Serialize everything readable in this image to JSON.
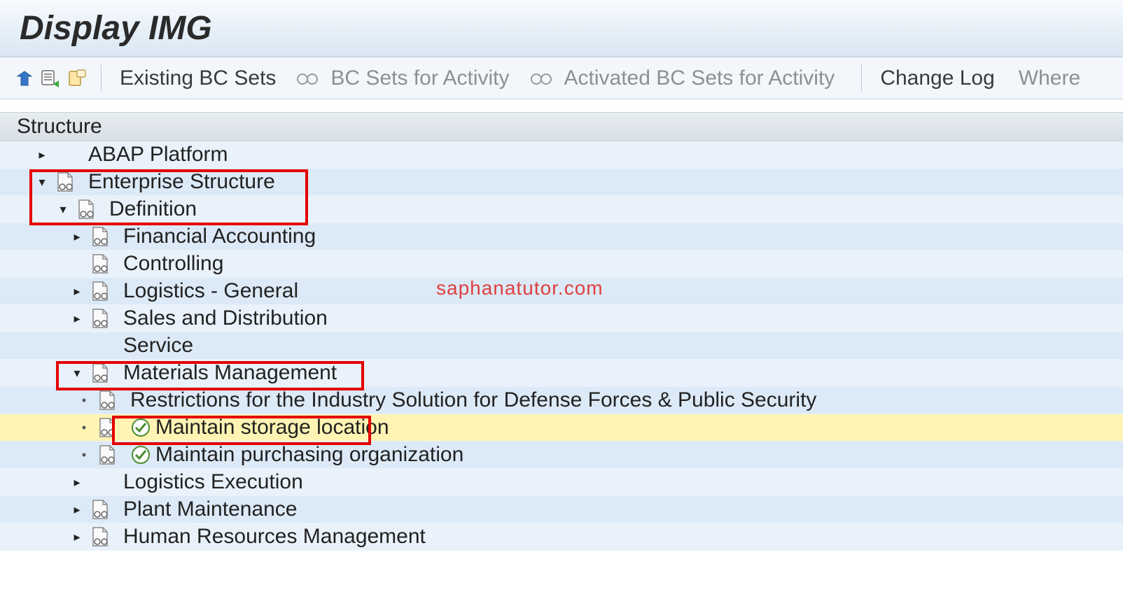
{
  "title": "Display IMG",
  "toolbar": {
    "existing_bc_sets": "Existing BC Sets",
    "bc_sets_for_activity": "BC Sets for Activity",
    "activated_bc_sets": "Activated BC Sets for Activity",
    "change_log": "Change Log",
    "where": "Where"
  },
  "section_header": "Structure",
  "watermark": "saphanatutor.com",
  "tree": {
    "abap_platform": "ABAP Platform",
    "enterprise_structure": "Enterprise Structure",
    "definition": "Definition",
    "financial_accounting": "Financial Accounting",
    "controlling": "Controlling",
    "logistics_general": "Logistics - General",
    "sales_and_distribution": "Sales and Distribution",
    "service": "Service",
    "materials_management": "Materials Management",
    "restrictions": "Restrictions for the Industry Solution for Defense Forces & Public Security",
    "maintain_storage_location": "Maintain storage location",
    "maintain_purchasing_org": "Maintain purchasing organization",
    "logistics_execution": "Logistics Execution",
    "plant_maintenance": "Plant Maintenance",
    "human_resources_management": "Human Resources Management"
  }
}
